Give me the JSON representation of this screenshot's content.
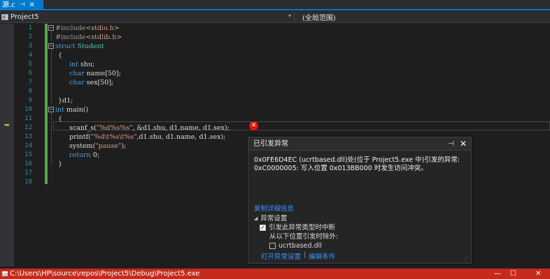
{
  "tab": {
    "name": "源.c",
    "pin": "⊣",
    "close": "✕"
  },
  "nav": {
    "project": "Project5",
    "scope": "(全局范围)",
    "dropdown": "▾"
  },
  "gutter": {
    "lines": [
      "1",
      "2",
      "3",
      "4",
      "5",
      "6",
      "7",
      "8",
      "9",
      "10",
      "11",
      "12",
      "13",
      "14",
      "15",
      "16",
      "17",
      "18"
    ]
  },
  "code": {
    "l1_a": "#include",
    "l1_b": "<stdio.h>",
    "l2_a": "#include",
    "l2_b": "<stdlib.h>",
    "l3_a": "struct",
    "l3_b": " Student",
    "l4": "{",
    "l5_a": "int",
    "l5_b": " shu;",
    "l6_a": "char",
    "l6_b": " name[50];",
    "l7_a": "char",
    "l7_b": " sex[50];",
    "l9": "}d1;",
    "l10_a": "int",
    "l10_b": " main()",
    "l11": "{",
    "l12_a": "scanf_s(",
    "l12_b": "\"%d%s%s\"",
    "l12_c": ", &d1.shu, d1.name, d1.sex);",
    "l13_a": "printf(",
    "l13_b": "\"%d\\t%s\\t%s\"",
    "l13_c": ",d1.shu, d1.name, d1.sex);",
    "l14_a": "system(",
    "l14_b": "\"pause\"",
    "l14_c": ");",
    "l15_a": "return",
    "l15_b": " 0;",
    "l16": "}"
  },
  "exception": {
    "title": "已引发异常",
    "pin": "⊣",
    "close": "✕",
    "message_1": "0x0FE6D4EC (ucrtbased.dll)处(位于 Project5.exe 中)引发的异常:",
    "message_2": "0xC0000005: 写入位置 0x013BB000 时发生访问冲突。",
    "copy_details": "复制详细信息",
    "settings_header": "异常设置",
    "break_label": "引发此异常类型时中断",
    "except_label": "从以下位置引发时除外:",
    "module_label": "ucrtbased.dll",
    "open_settings": "打开异常设置",
    "separator": "|",
    "edit_conditions": "编辑条件"
  },
  "console": {
    "title": "C:\\Users\\HP\\source\\repos\\Project5\\Debug\\Project5.exe",
    "minimize": "—",
    "maximize": "☐",
    "close": "✕"
  },
  "colors": {
    "accent": "#007acc",
    "error": "#e51400",
    "console_bar": "#c42b1c",
    "link": "#3794ff"
  }
}
